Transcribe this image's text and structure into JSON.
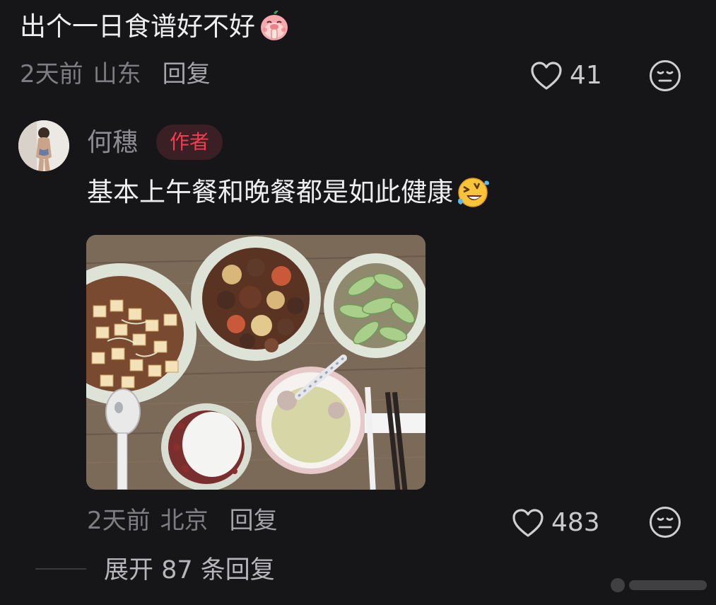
{
  "parent_comment": {
    "text": "出个一日食谱好不好",
    "emoji": "pig-praying-emoji",
    "time": "2天前",
    "location": "山东",
    "reply_label": "回复",
    "likes": "41"
  },
  "author_reply": {
    "name": "何穗",
    "badge": "作者",
    "text": "基本上午餐和晚餐都是如此健康",
    "emoji": "rolling-laughing-emoji",
    "time": "2天前",
    "location": "北京",
    "reply_label": "回复",
    "likes": "483"
  },
  "expand": {
    "label": "展开 87 条回复"
  },
  "colors": {
    "background": "#161619",
    "badge_text": "#f23d4f",
    "badge_bg": "#3a2025"
  }
}
